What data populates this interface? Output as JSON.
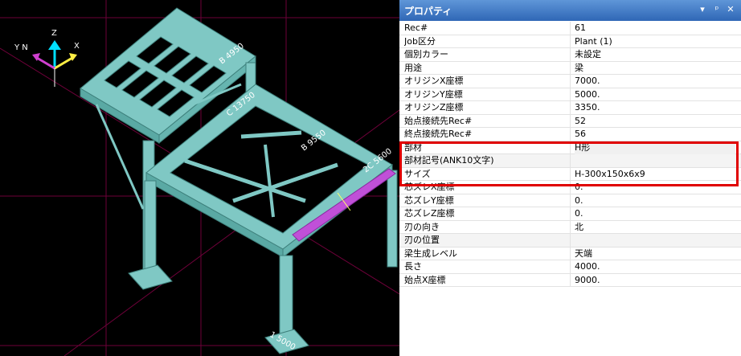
{
  "panel": {
    "title": "プロパティ",
    "controls": {
      "dropdown": "▾",
      "pin": "ᵖ",
      "close": "✕"
    },
    "rows": [
      {
        "key": "Rec#",
        "value": "61"
      },
      {
        "key": "Job区分",
        "value": "Plant (1)"
      },
      {
        "key": "個別カラー",
        "value": "未設定"
      },
      {
        "key": "用途",
        "value": "梁"
      },
      {
        "key": "オリジンX座標",
        "value": "7000."
      },
      {
        "key": "オリジンY座標",
        "value": "5000."
      },
      {
        "key": "オリジンZ座標",
        "value": "3350."
      },
      {
        "key": "始点接続先Rec#",
        "value": "52"
      },
      {
        "key": "終点接続先Rec#",
        "value": "56"
      },
      {
        "key": "部材",
        "value": "H形"
      },
      {
        "key": "部材記号(ANK10文字)",
        "value": ""
      },
      {
        "key": "サイズ",
        "value": "H-300x150x6x9"
      },
      {
        "key": "芯ズレX座標",
        "value": "0."
      },
      {
        "key": "芯ズレY座標",
        "value": "0."
      },
      {
        "key": "芯ズレZ座標",
        "value": "0."
      },
      {
        "key": "刃の向き",
        "value": "北"
      },
      {
        "key": "刃の位置",
        "value": ""
      },
      {
        "key": "梁生成レベル",
        "value": "天端"
      },
      {
        "key": "長さ",
        "value": "4000."
      },
      {
        "key": "始点X座標",
        "value": "9000."
      }
    ]
  },
  "viewport": {
    "axis": {
      "z": "Z",
      "x": "X",
      "yn": "Y N"
    },
    "dimensions": {
      "d1": "B 4950",
      "d2": "C 13750",
      "d3": "B 9550",
      "d4": "2C 5600",
      "d5": "1 5000"
    },
    "colors": {
      "background": "#000000",
      "steel": "#7fc8c4",
      "selected": "#c050d8",
      "grid": "#8a0048"
    }
  }
}
